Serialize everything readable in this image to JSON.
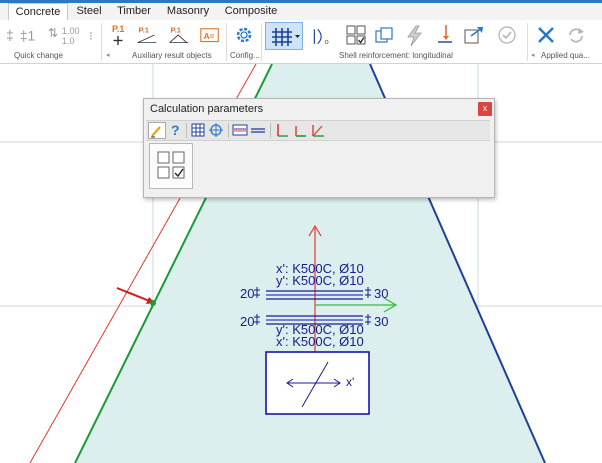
{
  "ribbon": {
    "tabs": [
      {
        "label": "Concrete",
        "active": true
      },
      {
        "label": "Steel",
        "active": false
      },
      {
        "label": "Timber",
        "active": false
      },
      {
        "label": "Masonry",
        "active": false
      },
      {
        "label": "Composite",
        "active": false
      }
    ],
    "groups": {
      "quick_change": "Quick change",
      "auxiliary": "Auxiliary result objects",
      "config": "Config...",
      "shell_reinforcement": "Shell reinforcement: longitudinal",
      "applied": "Applied qua..."
    },
    "quick_change_values": {
      "top": "1.00",
      "bottom": "1.0"
    },
    "p1_label": "P.1",
    "a_eq_label": "A="
  },
  "dialog": {
    "title": "Calculation parameters",
    "close": "x",
    "toolbar_icons": [
      "pencil-icon",
      "help-icon",
      "grid-icon",
      "target-icon",
      "rebar-layer-icon",
      "rebar-layer-alt-icon",
      "axis-red-icon",
      "axis-green-icon",
      "axis-diagonal-icon"
    ]
  },
  "drawing": {
    "top_x": "x': K500C, Ø10",
    "top_y": "y': K500C, Ø10",
    "bottom_y": "y': K500C, Ø10",
    "bottom_x": "x': K500C, Ø10",
    "cover_left_top": "20",
    "cover_right_top": "30",
    "cover_left_bottom": "20",
    "cover_right_bottom": "30",
    "local_axis": "x'"
  },
  "colors": {
    "accent": "#2b78c6",
    "region_fill": "#dcefee",
    "edge_blue": "#1f3f9c",
    "edge_green": "#1c9a3a",
    "red": "#e03a30",
    "label_blue": "#1a1a8c"
  }
}
